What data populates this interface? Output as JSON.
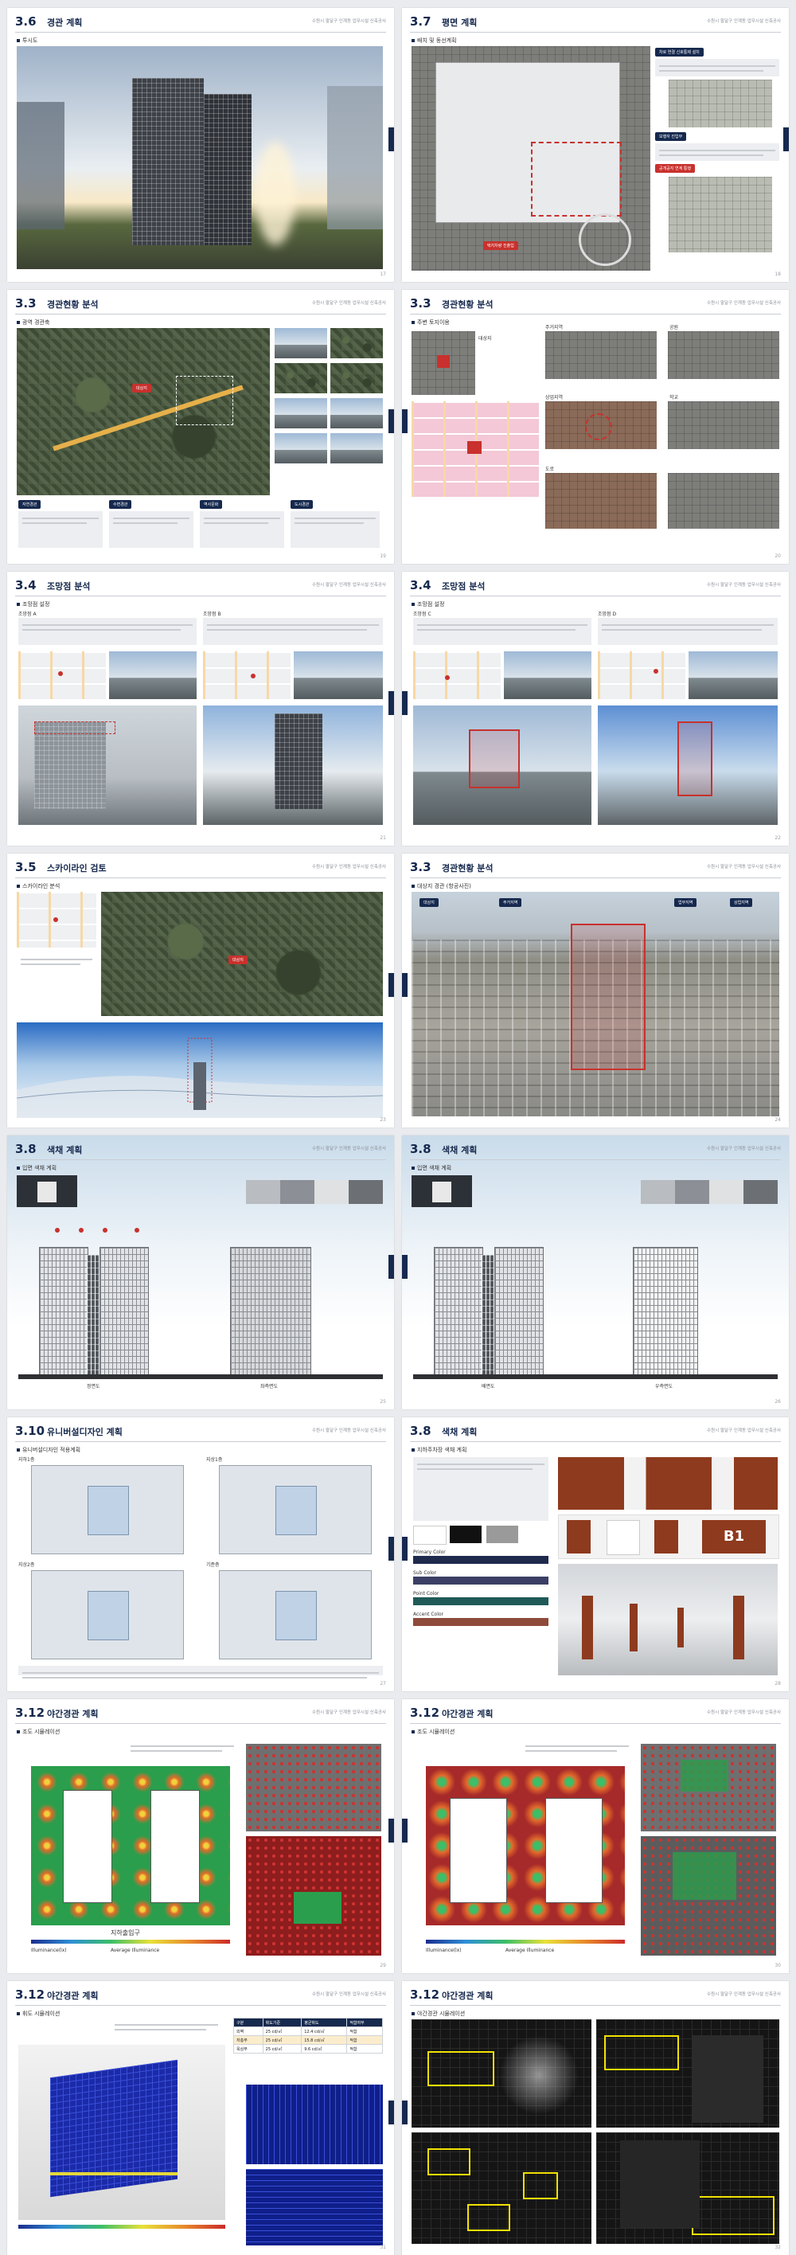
{
  "project": "수원시 팔달구 인계동 업무시설 신축공사",
  "pages": [
    {
      "num": "3.6",
      "title": "경관 계획",
      "sub": "투시도",
      "folio": "17"
    },
    {
      "num": "3.7",
      "title": "평면 계획",
      "sub": "배치 및 동선계획",
      "folio": "18",
      "chips": [
        "차로 연결 신호통제 설치",
        "택지차량 진출입",
        "보행자 진입부",
        "공개공지 연계 통행"
      ]
    },
    {
      "num": "3.3",
      "title": "경관현황 분석",
      "sub": "광역 경관축",
      "folio": "19",
      "chips": [
        "대상지",
        "자연경관",
        "수변경관",
        "역사문화",
        "도시경관"
      ]
    },
    {
      "num": "3.3",
      "title": "경관현황 분석",
      "sub": "주변 토지이용",
      "folio": "20",
      "labels": [
        "대상지",
        "주거지역",
        "공원",
        "상업지역",
        "학교",
        "도로"
      ]
    },
    {
      "num": "3.4",
      "title": "조망점 분석",
      "sub": "조망점 설정",
      "folio": "21",
      "cols": [
        "조망점 A",
        "조망점 B"
      ]
    },
    {
      "num": "3.4",
      "title": "조망점 분석",
      "sub": "조망점 설정",
      "folio": "22",
      "cols": [
        "조망점 C",
        "조망점 D"
      ]
    },
    {
      "num": "3.5",
      "title": "스카이라인 검토",
      "sub": "스카이라인 분석",
      "folio": "23",
      "chips": [
        "대상지"
      ]
    },
    {
      "num": "3.3",
      "title": "경관현황 분석",
      "sub": "대상지 경관 (항공사진)",
      "folio": "24",
      "chips": [
        "대상지",
        "주거지역",
        "업무지역",
        "상업지역"
      ]
    },
    {
      "num": "3.8",
      "title": "색채 계획",
      "sub": "입면 색채 계획",
      "folio": "25",
      "labels": [
        "정면도",
        "좌측면도"
      ]
    },
    {
      "num": "3.8",
      "title": "색채 계획",
      "sub": "입면 색채 계획",
      "folio": "26",
      "labels": [
        "배면도",
        "우측면도"
      ]
    },
    {
      "num": "3.10",
      "title": "유니버설디자인 계획",
      "sub": "유니버설디자인 적용계획",
      "folio": "27",
      "plans": [
        "지하1층",
        "지상1층",
        "지상2층",
        "기준층"
      ]
    },
    {
      "num": "3.8",
      "title": "색채 계획",
      "sub": "지하주차장 색채 계획",
      "folio": "28",
      "tags": [
        "B1"
      ],
      "bars": [
        "Primary Color",
        "Sub Color",
        "Point Color",
        "Accent Color"
      ]
    },
    {
      "num": "3.12",
      "title": "야간경관 계획",
      "sub": "조도 시뮬레이션",
      "folio": "29",
      "labels": [
        "지하출입구"
      ],
      "legend": [
        "Illuminance(lx)",
        "Average Illuminance"
      ]
    },
    {
      "num": "3.12",
      "title": "야간경관 계획",
      "sub": "조도 시뮬레이션",
      "folio": "30",
      "legend": [
        "Illuminance(lx)",
        "Average Illuminance"
      ]
    },
    {
      "num": "3.12",
      "title": "야간경관 계획",
      "sub": "휘도 시뮬레이션",
      "folio": "31",
      "table": [
        [
          "구분",
          "휘도기준",
          "평균휘도",
          "적합여부"
        ],
        [
          "외벽",
          "25 cd/㎡",
          "12.4 cd/㎡",
          "적합"
        ],
        [
          "저층부",
          "25 cd/㎡",
          "15.8 cd/㎡",
          "적합"
        ],
        [
          "옥상부",
          "25 cd/㎡",
          "9.6 cd/㎡",
          "적합"
        ]
      ]
    },
    {
      "num": "3.12",
      "title": "야간경관 계획",
      "sub": "야간경관 시뮬레이션",
      "folio": "32"
    }
  ],
  "icons": {
    "tab": "section-tab"
  },
  "colors": {
    "navy": "#16294e",
    "red": "#c8312d",
    "brown": "#8e3a1e"
  }
}
